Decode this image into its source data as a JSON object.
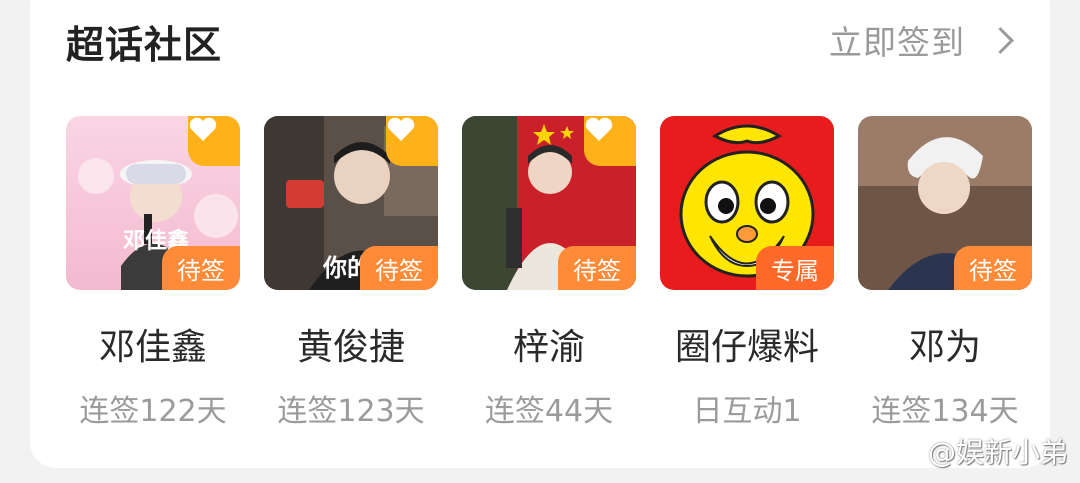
{
  "header": {
    "title": "超话社区",
    "signin_label": "立即签到"
  },
  "communities": [
    {
      "name": "邓佳鑫",
      "status": "待签",
      "streak": "连签122天",
      "poster_text": "邓佳鑫"
    },
    {
      "name": "黄俊捷",
      "status": "待签",
      "streak": "连签123天",
      "poster_text": "你的心"
    },
    {
      "name": "梓渝",
      "status": "待签",
      "streak": "连签44天"
    },
    {
      "name": "圈仔爆料",
      "status": "专属",
      "streak": "日互动1"
    },
    {
      "name": "邓为",
      "status": "待签",
      "streak": "连签134天"
    }
  ],
  "watermark": {
    "text": "@娱新小弟"
  },
  "colors": {
    "badge": "#ff8a37",
    "fav": "#ffb11a",
    "title": "#222222",
    "muted": "#9b9b9b"
  }
}
